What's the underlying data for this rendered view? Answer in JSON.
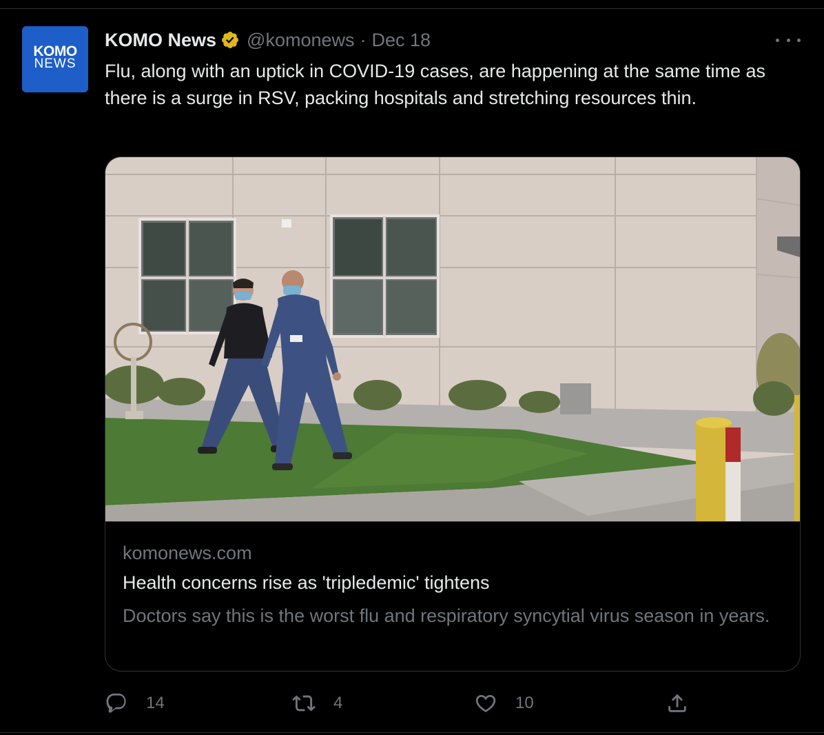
{
  "tweet": {
    "avatar": {
      "logo_line1": "KOMO",
      "logo_line2": "NEWS",
      "color": "#1d5ec8"
    },
    "author": {
      "display_name": "KOMO News",
      "verified_badge": "gold-verified-icon",
      "handle": "@komonews",
      "separator": "·",
      "date": "Dec 18"
    },
    "text": "Flu, along with an uptick in COVID-19 cases, are happening at the same time as there is a surge in RSV, packing hospitals and stretching resources thin.",
    "more_menu_icon": "more-horizontal-icon",
    "card": {
      "image": "photo: two masked healthcare workers in scrubs walking on grass beside a hospital building",
      "domain": "komonews.com",
      "title": "Health concerns rise as 'tripledemic' tightens",
      "description": "Doctors say this is the worst flu and respiratory syncytial virus season in years."
    },
    "actions": {
      "reply": {
        "icon": "reply-icon",
        "count": "14"
      },
      "retweet": {
        "icon": "retweet-icon",
        "count": "4"
      },
      "like": {
        "icon": "heart-icon",
        "count": "10"
      },
      "share": {
        "icon": "share-icon"
      }
    }
  },
  "colors": {
    "background": "#000000",
    "text_primary": "#e7e9ea",
    "text_secondary": "#71767b",
    "border": "#2f3336",
    "verified_gold": "#e2b719"
  }
}
